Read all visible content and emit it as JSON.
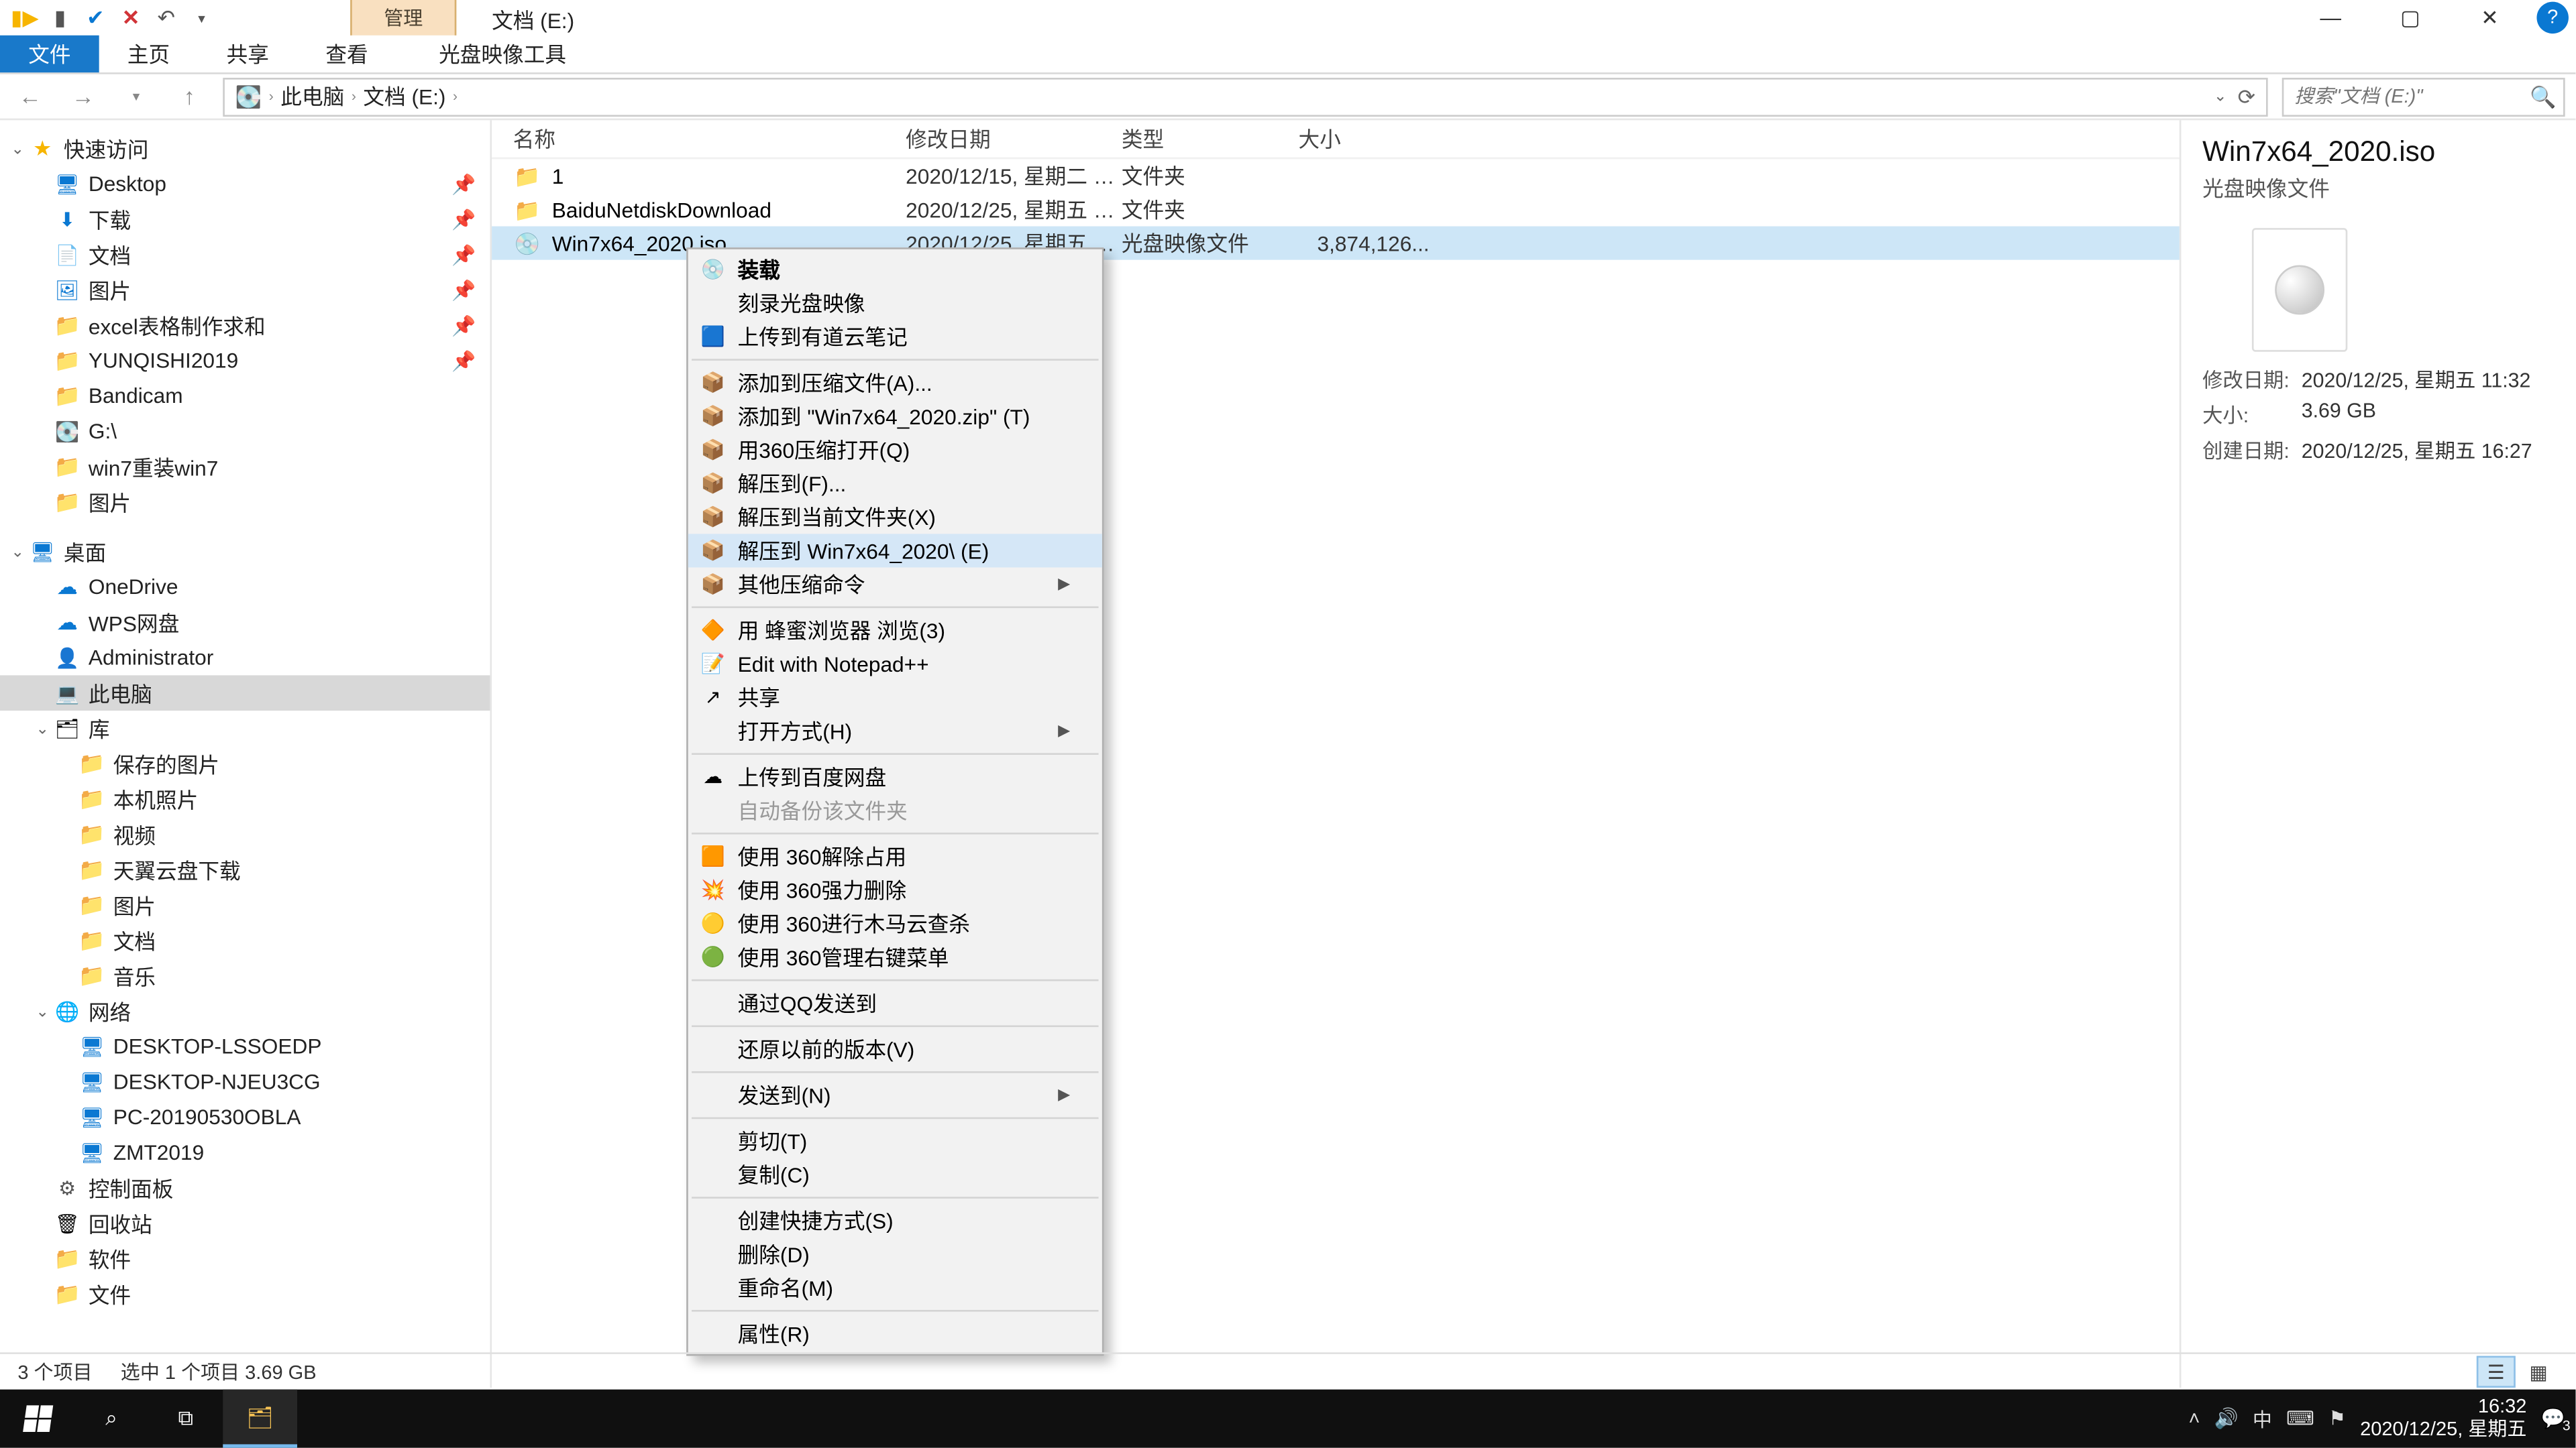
{
  "window": {
    "title_tab": "管理",
    "title_doc": "文档 (E:)"
  },
  "ribbon": {
    "file": "文件",
    "home": "主页",
    "share": "共享",
    "view": "查看",
    "disc_tools": "光盘映像工具"
  },
  "nav": {
    "crumbs": [
      "此电脑",
      "文档 (E:)"
    ],
    "search_placeholder": "搜索\"文档 (E:)\""
  },
  "tree": [
    {
      "indent": 1,
      "icon": "star",
      "label": "快速访问",
      "twisty": "open"
    },
    {
      "indent": 2,
      "icon": "desk",
      "label": "Desktop",
      "pin": true
    },
    {
      "indent": 2,
      "icon": "down",
      "label": "下载",
      "pin": true
    },
    {
      "indent": 2,
      "icon": "doc",
      "label": "文档",
      "pin": true
    },
    {
      "indent": 2,
      "icon": "pic",
      "label": "图片",
      "pin": true
    },
    {
      "indent": 2,
      "icon": "folder",
      "label": "excel表格制作求和",
      "pin": true
    },
    {
      "indent": 2,
      "icon": "folder",
      "label": "YUNQISHI2019",
      "pin": true
    },
    {
      "indent": 2,
      "icon": "folder",
      "label": "Bandicam"
    },
    {
      "indent": 2,
      "icon": "drive",
      "label": "G:\\"
    },
    {
      "indent": 2,
      "icon": "folder",
      "label": "win7重装win7"
    },
    {
      "indent": 2,
      "icon": "folder",
      "label": "图片"
    },
    {
      "indent": 1,
      "icon": "desk",
      "label": "桌面",
      "twisty": "open",
      "gap": true
    },
    {
      "indent": 2,
      "icon": "cloud",
      "label": "OneDrive"
    },
    {
      "indent": 2,
      "icon": "cloud",
      "label": "WPS网盘"
    },
    {
      "indent": 2,
      "icon": "user",
      "label": "Administrator"
    },
    {
      "indent": 2,
      "icon": "pc",
      "label": "此电脑",
      "selected": true
    },
    {
      "indent": 2,
      "icon": "lib",
      "label": "库",
      "twisty": "open"
    },
    {
      "indent": 3,
      "icon": "folder",
      "label": "保存的图片"
    },
    {
      "indent": 3,
      "icon": "folder",
      "label": "本机照片"
    },
    {
      "indent": 3,
      "icon": "folder",
      "label": "视频"
    },
    {
      "indent": 3,
      "icon": "folder",
      "label": "天翼云盘下载"
    },
    {
      "indent": 3,
      "icon": "folder",
      "label": "图片"
    },
    {
      "indent": 3,
      "icon": "folder",
      "label": "文档"
    },
    {
      "indent": 3,
      "icon": "folder",
      "label": "音乐"
    },
    {
      "indent": 2,
      "icon": "net",
      "label": "网络",
      "twisty": "open"
    },
    {
      "indent": 3,
      "icon": "mon",
      "label": "DESKTOP-LSSOEDP"
    },
    {
      "indent": 3,
      "icon": "mon",
      "label": "DESKTOP-NJEU3CG"
    },
    {
      "indent": 3,
      "icon": "mon",
      "label": "PC-20190530OBLA"
    },
    {
      "indent": 3,
      "icon": "mon",
      "label": "ZMT2019"
    },
    {
      "indent": 2,
      "icon": "ctrl",
      "label": "控制面板"
    },
    {
      "indent": 2,
      "icon": "rec",
      "label": "回收站"
    },
    {
      "indent": 2,
      "icon": "folder",
      "label": "软件"
    },
    {
      "indent": 2,
      "icon": "folder",
      "label": "文件"
    }
  ],
  "columns": {
    "name": "名称",
    "date": "修改日期",
    "type": "类型",
    "size": "大小"
  },
  "rows": [
    {
      "ico": "folder-g",
      "name": "1",
      "date": "2020/12/15, 星期二 1...",
      "type": "文件夹",
      "size": ""
    },
    {
      "ico": "folder-g",
      "name": "BaiduNetdiskDownload",
      "date": "2020/12/25, 星期五 1...",
      "type": "文件夹",
      "size": ""
    },
    {
      "ico": "iso-g",
      "name": "Win7x64_2020.iso",
      "date": "2020/12/25, 星期五 1...",
      "type": "光盘映像文件",
      "size": "3,874,126...",
      "selected": true
    }
  ],
  "details": {
    "title": "Win7x64_2020.iso",
    "subtitle": "光盘映像文件",
    "meta": [
      {
        "k": "修改日期:",
        "v": "2020/12/25, 星期五 11:32"
      },
      {
        "k": "大小:",
        "v": "3.69 GB"
      },
      {
        "k": "创建日期:",
        "v": "2020/12/25, 星期五 16:27"
      }
    ]
  },
  "context_menu": [
    {
      "label": "装载",
      "bold": true,
      "ico": "💿"
    },
    {
      "label": "刻录光盘映像"
    },
    {
      "label": "上传到有道云笔记",
      "ico": "🟦"
    },
    {
      "sep": true
    },
    {
      "label": "添加到压缩文件(A)...",
      "ico": "📦"
    },
    {
      "label": "添加到 \"Win7x64_2020.zip\" (T)",
      "ico": "📦"
    },
    {
      "label": "用360压缩打开(Q)",
      "ico": "📦"
    },
    {
      "label": "解压到(F)...",
      "ico": "📦"
    },
    {
      "label": "解压到当前文件夹(X)",
      "ico": "📦"
    },
    {
      "label": "解压到 Win7x64_2020\\ (E)",
      "ico": "📦",
      "hov": true
    },
    {
      "label": "其他压缩命令",
      "ico": "📦",
      "sub": true
    },
    {
      "sep": true
    },
    {
      "label": "用 蜂蜜浏览器 浏览(3)",
      "ico": "🔶"
    },
    {
      "label": "Edit with Notepad++",
      "ico": "📝"
    },
    {
      "label": "共享",
      "ico": "↗"
    },
    {
      "label": "打开方式(H)",
      "sub": true
    },
    {
      "sep": true
    },
    {
      "label": "上传到百度网盘",
      "ico": "☁"
    },
    {
      "label": "自动备份该文件夹",
      "disabled": true
    },
    {
      "sep": true
    },
    {
      "label": "使用 360解除占用",
      "ico": "🟧"
    },
    {
      "label": "使用 360强力删除",
      "ico": "💥"
    },
    {
      "label": "使用 360进行木马云查杀",
      "ico": "🟡"
    },
    {
      "label": "使用 360管理右键菜单",
      "ico": "🟢"
    },
    {
      "sep": true
    },
    {
      "label": "通过QQ发送到"
    },
    {
      "sep": true
    },
    {
      "label": "还原以前的版本(V)"
    },
    {
      "sep": true
    },
    {
      "label": "发送到(N)",
      "sub": true
    },
    {
      "sep": true
    },
    {
      "label": "剪切(T)"
    },
    {
      "label": "复制(C)"
    },
    {
      "sep": true
    },
    {
      "label": "创建快捷方式(S)"
    },
    {
      "label": "删除(D)"
    },
    {
      "label": "重命名(M)"
    },
    {
      "sep": true
    },
    {
      "label": "属性(R)"
    }
  ],
  "status": {
    "count": "3 个项目",
    "selection": "选中 1 个项目  3.69 GB"
  },
  "taskbar": {
    "time": "16:32",
    "date": "2020/12/25, 星期五",
    "ime": "中",
    "notif_count": "3"
  }
}
